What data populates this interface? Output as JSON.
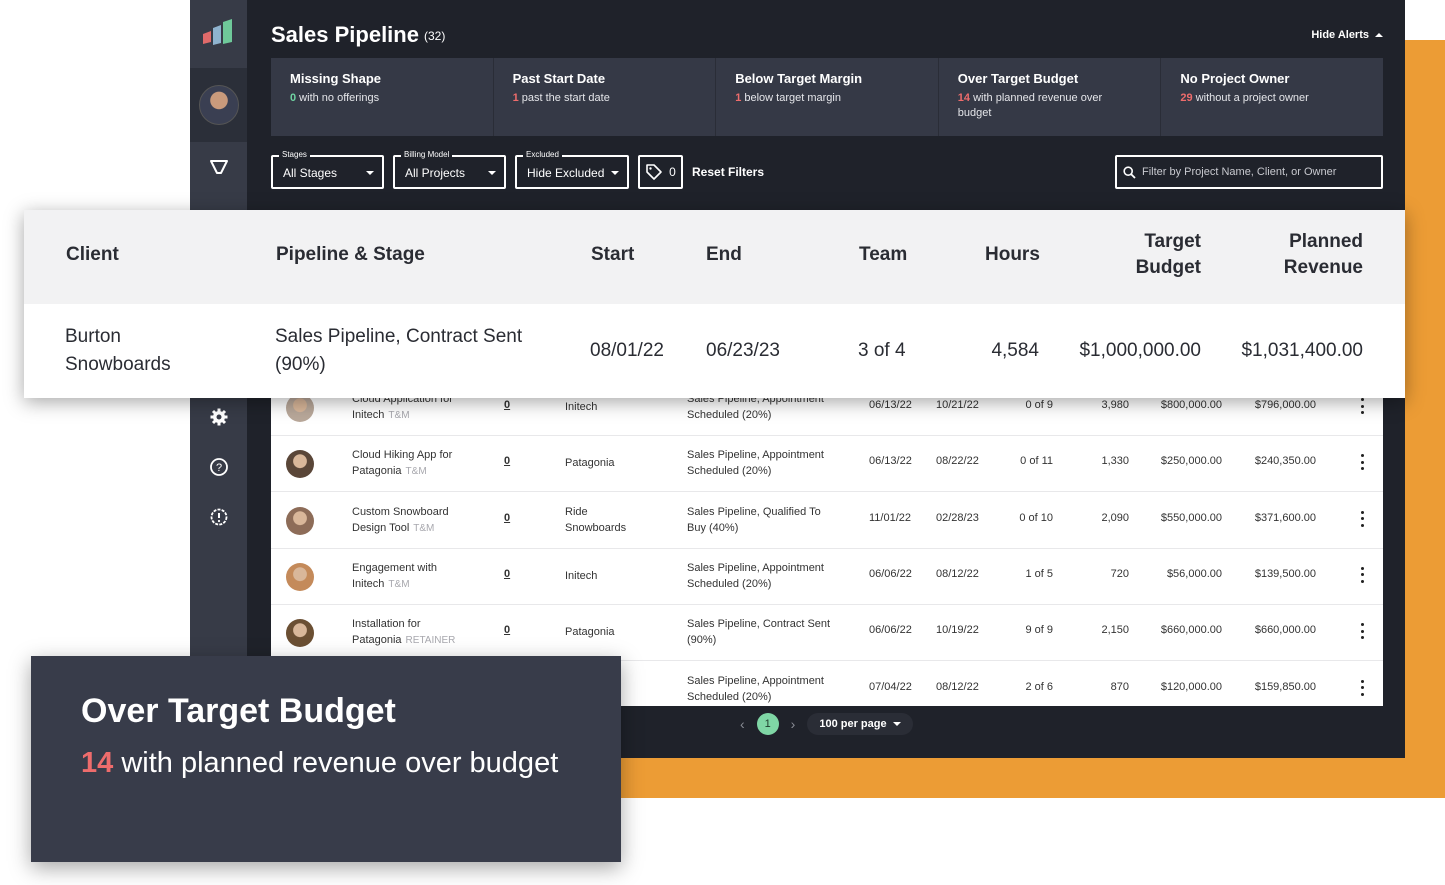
{
  "header": {
    "title": "Sales Pipeline",
    "count": "(32)",
    "hide_alerts_label": "Hide Alerts"
  },
  "alerts": [
    {
      "title": "Missing Shape",
      "num": "0",
      "text": " with no offerings",
      "num_color": "green"
    },
    {
      "title": "Past Start Date",
      "num": "1",
      "text": " past the start date",
      "num_color": "red"
    },
    {
      "title": "Below Target Margin",
      "num": "1",
      "text": " below target margin",
      "num_color": "red"
    },
    {
      "title": "Over Target Budget",
      "num": "14",
      "text": " with planned revenue over budget",
      "num_color": "red"
    },
    {
      "title": "No Project Owner",
      "num": "29",
      "text": " without a project owner",
      "num_color": "red"
    }
  ],
  "filters": {
    "stages": {
      "label": "Stages",
      "value": "All Stages"
    },
    "billing": {
      "label": "Billing Model",
      "value": "All Projects"
    },
    "excluded": {
      "label": "Excluded",
      "value": "Hide Excluded"
    },
    "tags_count": "0",
    "reset_label": "Reset Filters",
    "search_placeholder": "Filter by Project Name, Client, or Owner"
  },
  "zoomed": {
    "headers": {
      "client": "Client",
      "pipeline": "Pipeline & Stage",
      "start": "Start",
      "end": "End",
      "team": "Team",
      "hours": "Hours",
      "budget_1": "Target",
      "budget_2": "Budget",
      "revenue_1": "Planned",
      "revenue_2": "Revenue"
    },
    "row": {
      "client_1": "Burton",
      "client_2": "Snowboards",
      "stage_1": "Sales Pipeline, Contract Sent",
      "stage_2": "(90%)",
      "start": "08/01/22",
      "end": "06/23/23",
      "team": "3 of 4",
      "hours": "4,584",
      "budget": "$1,000,000.00",
      "revenue": "$1,031,400.00"
    }
  },
  "rows": [
    {
      "name_1": "Cloud Application for",
      "name_2": "Initech",
      "billing": "T&M",
      "zero": "0",
      "client": "Initech",
      "stage_1": "Sales Pipeline, Appointment",
      "stage_2": "Scheduled (20%)",
      "start": "06/13/22",
      "end": "10/21/22",
      "team": "0 of 9",
      "hours": "3,980",
      "budget": "$800,000.00",
      "revenue": "$796,000.00",
      "avatar_color": "#b9a89a"
    },
    {
      "name_1": "Cloud Hiking App for",
      "name_2": "Patagonia",
      "billing": "T&M",
      "zero": "0",
      "client": "Patagonia",
      "stage_1": "Sales Pipeline, Appointment",
      "stage_2": "Scheduled (20%)",
      "start": "06/13/22",
      "end": "08/22/22",
      "team": "0 of 11",
      "hours": "1,330",
      "budget": "$250,000.00",
      "revenue": "$240,350.00",
      "avatar_color": "#5a4638"
    },
    {
      "name_1": "Custom Snowboard",
      "name_2": "Design Tool",
      "billing": "T&M",
      "zero": "0",
      "client": "Ride Snowboards",
      "stage_1": "Sales Pipeline, Qualified To",
      "stage_2": "Buy (40%)",
      "start": "11/01/22",
      "end": "02/28/23",
      "team": "0 of 10",
      "hours": "2,090",
      "budget": "$550,000.00",
      "revenue": "$371,600.00",
      "avatar_color": "#8d6c58"
    },
    {
      "name_1": "Engagement with",
      "name_2": "Initech",
      "billing": "T&M",
      "zero": "0",
      "client": "Initech",
      "stage_1": "Sales Pipeline, Appointment",
      "stage_2": "Scheduled (20%)",
      "start": "06/06/22",
      "end": "08/12/22",
      "team": "1 of 5",
      "hours": "720",
      "budget": "$56,000.00",
      "revenue": "$139,500.00",
      "avatar_color": "#c48a5a"
    },
    {
      "name_1": "Installation for",
      "name_2": "Patagonia",
      "billing": "RETAINER",
      "zero": "0",
      "client": "Patagonia",
      "stage_1": "Sales Pipeline, Contract Sent",
      "stage_2": "(90%)",
      "start": "06/06/22",
      "end": "10/19/22",
      "team": "9 of 9",
      "hours": "2,150",
      "budget": "$660,000.00",
      "revenue": "$660,000.00",
      "avatar_color": "#6b4f33"
    },
    {
      "name_1": "",
      "name_2": "",
      "billing": "",
      "zero": "",
      "client": "",
      "stage_1": "Sales Pipeline, Appointment",
      "stage_2": "Scheduled (20%)",
      "start": "07/04/22",
      "end": "08/12/22",
      "team": "2 of 6",
      "hours": "870",
      "budget": "$120,000.00",
      "revenue": "$159,850.00",
      "avatar_color": ""
    }
  ],
  "pagination": {
    "current_page": "1",
    "per_page_label": "100 per page"
  },
  "tooltip": {
    "title": "Over Target Budget",
    "num": "14",
    "text": " with planned revenue over budget"
  },
  "colors": {
    "accent_orange": "#ec9c35",
    "alert_red": "#ee6c6c",
    "alert_green": "#6fd3a2",
    "page_active": "#7fd6a5"
  }
}
